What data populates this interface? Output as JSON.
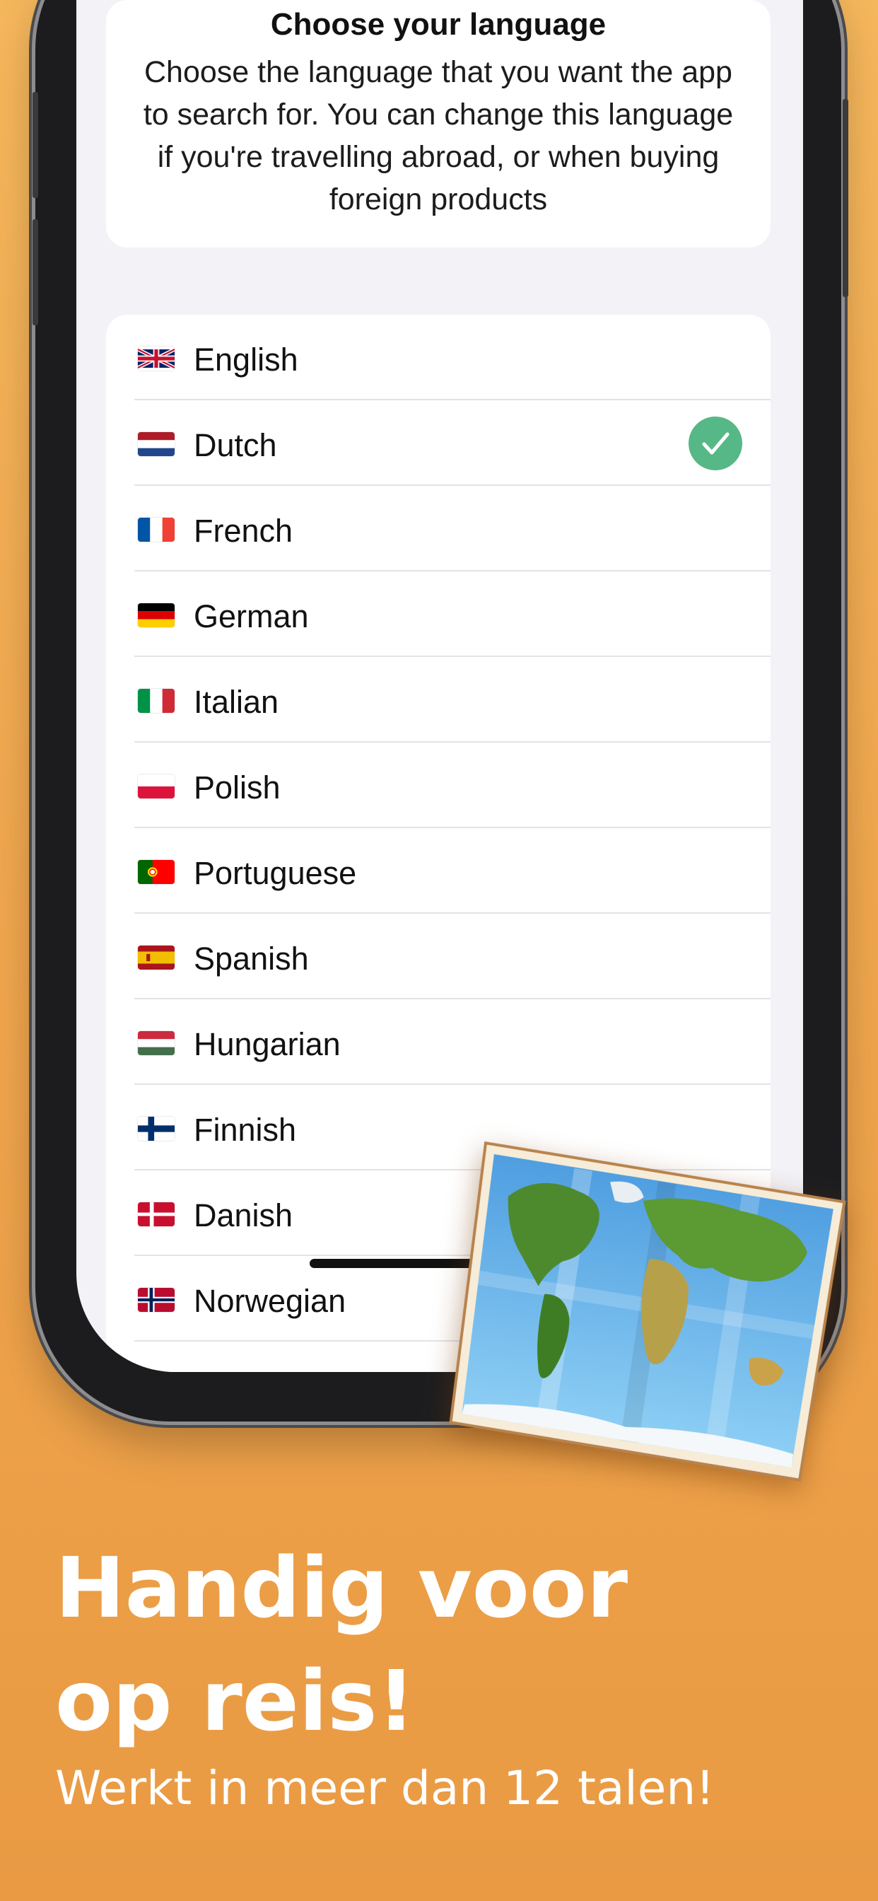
{
  "settings": {
    "title": "Choose your language",
    "description": "Choose the language that you want the app to search for. You can change this language if you're travelling abroad, or when buying foreign products",
    "selected_language": "Dutch",
    "languages": [
      {
        "flag": "flag-gb",
        "label": "English"
      },
      {
        "flag": "flag-nl",
        "label": "Dutch"
      },
      {
        "flag": "flag-fr",
        "label": "French"
      },
      {
        "flag": "flag-de",
        "label": "German"
      },
      {
        "flag": "flag-it",
        "label": "Italian"
      },
      {
        "flag": "flag-pl",
        "label": "Polish"
      },
      {
        "flag": "flag-pt",
        "label": "Portuguese"
      },
      {
        "flag": "flag-es",
        "label": "Spanish"
      },
      {
        "flag": "flag-hu",
        "label": "Hungarian"
      },
      {
        "flag": "flag-fi",
        "label": "Finnish"
      },
      {
        "flag": "flag-dk",
        "label": "Danish"
      },
      {
        "flag": "flag-no",
        "label": "Norwegian"
      }
    ]
  },
  "promo": {
    "headline_line1": "Handig voor",
    "headline_line2": "op reis!",
    "subline": "Werkt in meer dan 12 talen!"
  },
  "colors": {
    "background_top": "#f5b75c",
    "background_bottom": "#e99a43",
    "check": "#56b886"
  }
}
